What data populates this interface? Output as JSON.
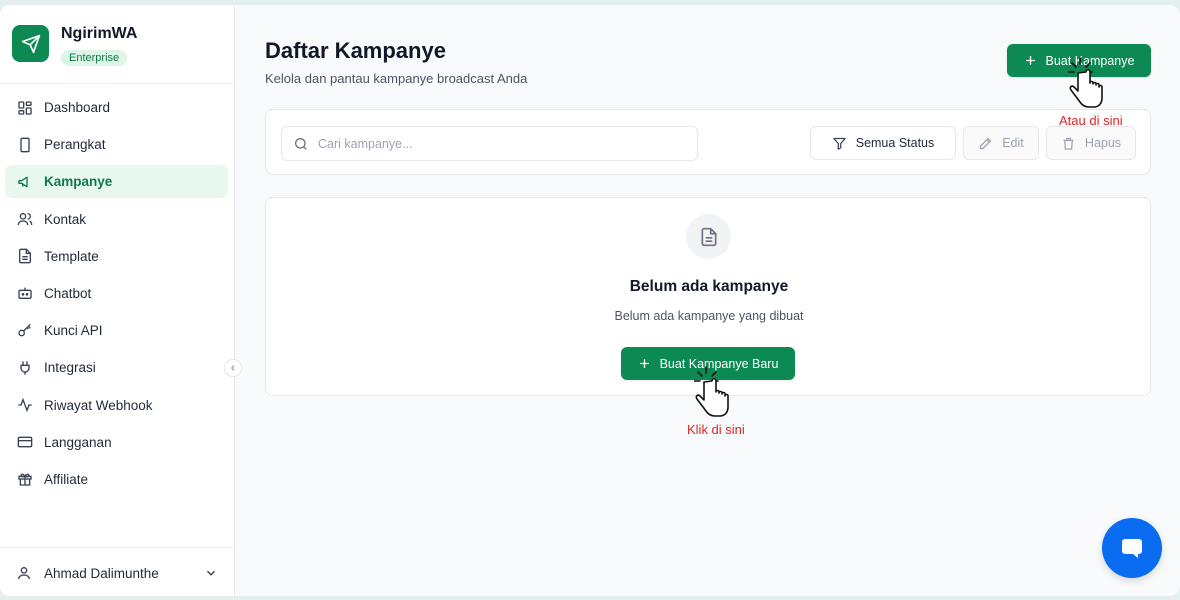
{
  "brand": {
    "name": "NgirimWA",
    "plan_badge": "Enterprise"
  },
  "sidebar": {
    "items": [
      {
        "label": "Dashboard",
        "icon": "dashboard-icon",
        "active": false
      },
      {
        "label": "Perangkat",
        "icon": "device-icon",
        "active": false
      },
      {
        "label": "Kampanye",
        "icon": "megaphone-icon",
        "active": true
      },
      {
        "label": "Kontak",
        "icon": "users-icon",
        "active": false
      },
      {
        "label": "Template",
        "icon": "document-icon",
        "active": false
      },
      {
        "label": "Chatbot",
        "icon": "bot-icon",
        "active": false
      },
      {
        "label": "Kunci API",
        "icon": "key-icon",
        "active": false
      },
      {
        "label": "Integrasi",
        "icon": "plug-icon",
        "active": false
      },
      {
        "label": "Riwayat Webhook",
        "icon": "activity-icon",
        "active": false
      },
      {
        "label": "Langganan",
        "icon": "credit-card-icon",
        "active": false
      },
      {
        "label": "Affiliate",
        "icon": "gift-icon",
        "active": false
      }
    ],
    "user": {
      "name": "Ahmad Dalimunthe"
    }
  },
  "main": {
    "title": "Daftar Kampanye",
    "subtitle": "Kelola dan pantau kampanye broadcast Anda",
    "create_button": "Buat Kampanye",
    "search": {
      "placeholder": "Cari kampanye...",
      "value": ""
    },
    "filter_status": "Semua Status",
    "edit_button": "Edit",
    "delete_button": "Hapus",
    "empty": {
      "title": "Belum ada kampanye",
      "subtitle": "Belum ada kampanye yang dibuat",
      "create_button": "Buat Kampanye Baru"
    }
  },
  "annotations": {
    "top_hint": "Atau di sini",
    "mid_hint": "Klik di sini"
  },
  "colors": {
    "primary": "#0d8a53",
    "active_bg": "#e9f8ef",
    "hint": "#dc2626",
    "chat_fab": "#0a6cf0"
  }
}
